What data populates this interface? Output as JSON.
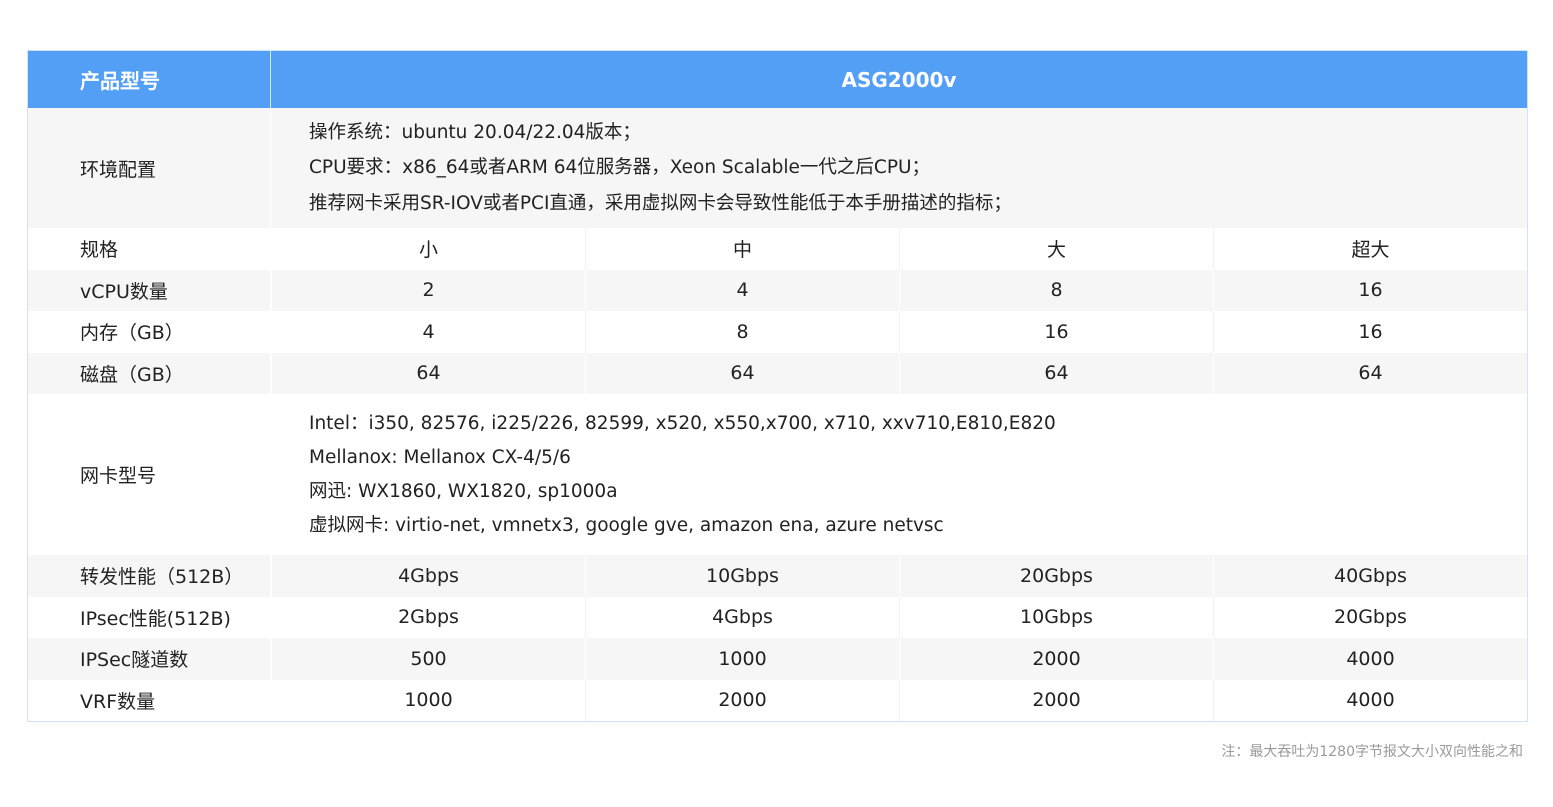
{
  "header": {
    "label": "产品型号",
    "title": "ASG2000v"
  },
  "environment": {
    "label": "环境配置",
    "lines": [
      "操作系统：ubuntu 20.04/22.04版本；",
      "CPU要求：x86_64或者ARM 64位服务器，Xeon Scalable一代之后CPU；",
      "推荐网卡采用SR-IOV或者PCI直通，采用虚拟网卡会导致性能低于本手册描述的指标；"
    ]
  },
  "rows_top": [
    {
      "label": "规格",
      "values": [
        "小",
        "中",
        "大",
        "超大"
      ]
    },
    {
      "label": "vCPU数量",
      "values": [
        "2",
        "4",
        "8",
        "16"
      ]
    },
    {
      "label": "内存（GB）",
      "values": [
        "4",
        "8",
        "16",
        "16"
      ]
    },
    {
      "label": "磁盘（GB）",
      "values": [
        "64",
        "64",
        "64",
        "64"
      ]
    }
  ],
  "nic": {
    "label": "网卡型号",
    "lines": [
      "Intel：i350, 82576, i225/226, 82599, x520, x550,x700, x710, xxv710,E810,E820",
      "Mellanox: Mellanox CX-4/5/6",
      "网迅: WX1860, WX1820, sp1000a",
      "虚拟网卡: virtio-net, vmnetx3, google gve, amazon ena, azure netvsc"
    ]
  },
  "rows_bottom": [
    {
      "label": "转发性能（512B）",
      "values": [
        "4Gbps",
        "10Gbps",
        "20Gbps",
        "40Gbps"
      ]
    },
    {
      "label": "IPsec性能(512B)",
      "values": [
        "2Gbps",
        "4Gbps",
        "10Gbps",
        "20Gbps"
      ]
    },
    {
      "label": "IPSec隧道数",
      "values": [
        "500",
        "1000",
        "2000",
        "4000"
      ]
    },
    {
      "label": "VRF数量",
      "values": [
        "1000",
        "2000",
        "2000",
        "4000"
      ]
    }
  ],
  "footnote": "注：最大吞吐为1280字节报文大小双向性能之和"
}
